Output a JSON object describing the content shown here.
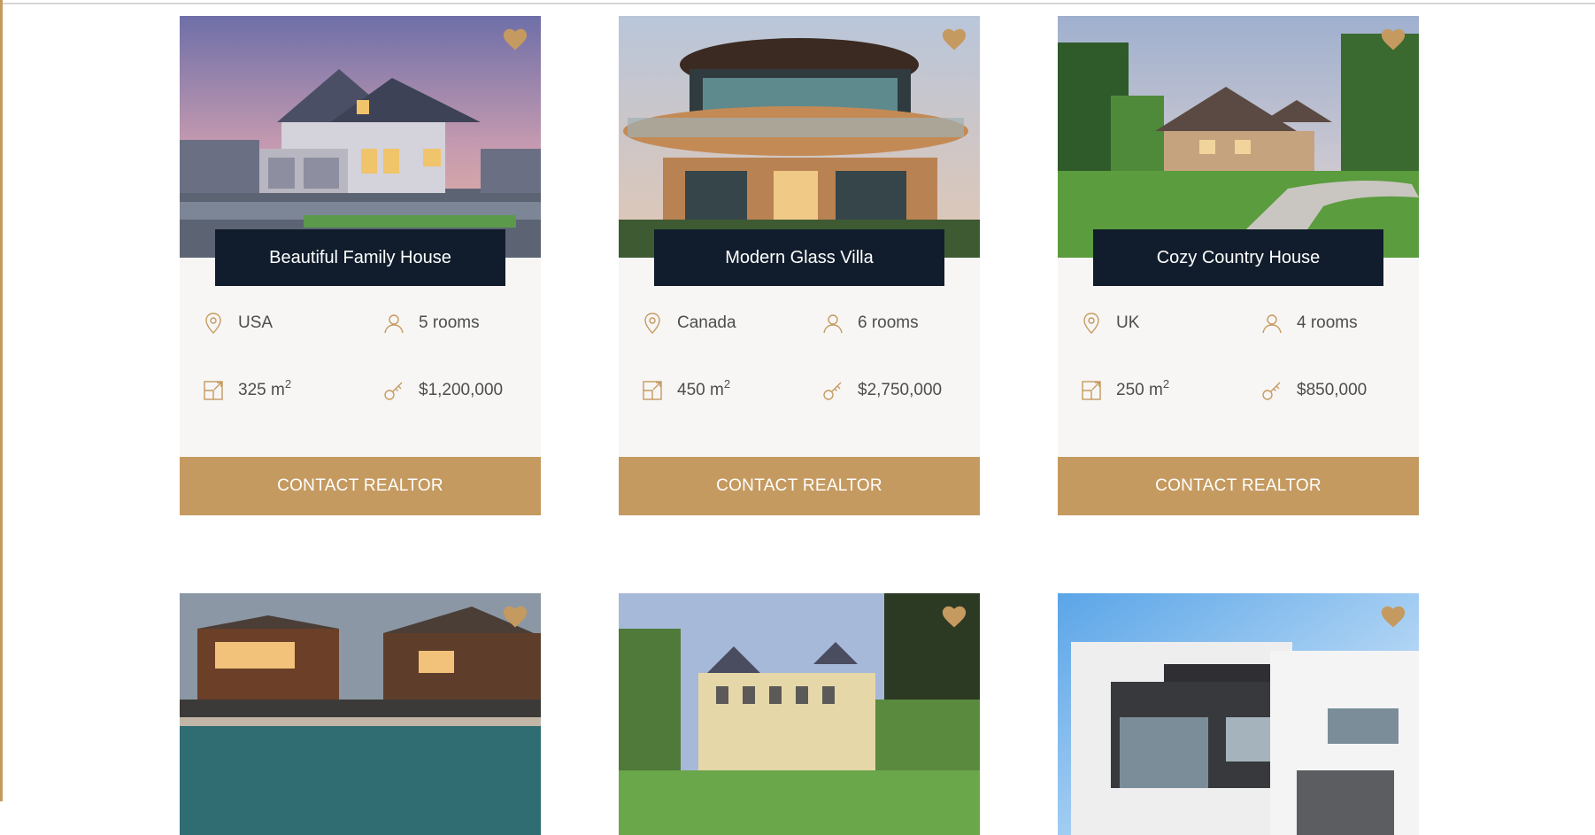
{
  "colors": {
    "accent": "#c59a60",
    "title_bg": "#111d2c",
    "info_bg": "#f7f6f4"
  },
  "listings": [
    {
      "title": "Beautiful Family House",
      "location": "USA",
      "rooms": "5 rooms",
      "area": "325 m",
      "area_unit_sup": "2",
      "price": "$1,200,000",
      "cta": "CONTACT REALTOR",
      "favorite_icon": "heart-icon"
    },
    {
      "title": "Modern Glass Villa",
      "location": "Canada",
      "rooms": "6 rooms",
      "area": "450 m",
      "area_unit_sup": "2",
      "price": "$2,750,000",
      "cta": "CONTACT REALTOR",
      "favorite_icon": "heart-icon"
    },
    {
      "title": "Cozy Country House",
      "location": "UK",
      "rooms": "4 rooms",
      "area": "250 m",
      "area_unit_sup": "2",
      "price": "$850,000",
      "cta": "CONTACT REALTOR",
      "favorite_icon": "heart-icon"
    },
    {
      "favorite_icon": "heart-icon"
    },
    {
      "favorite_icon": "heart-icon"
    },
    {
      "favorite_icon": "heart-icon"
    }
  ]
}
